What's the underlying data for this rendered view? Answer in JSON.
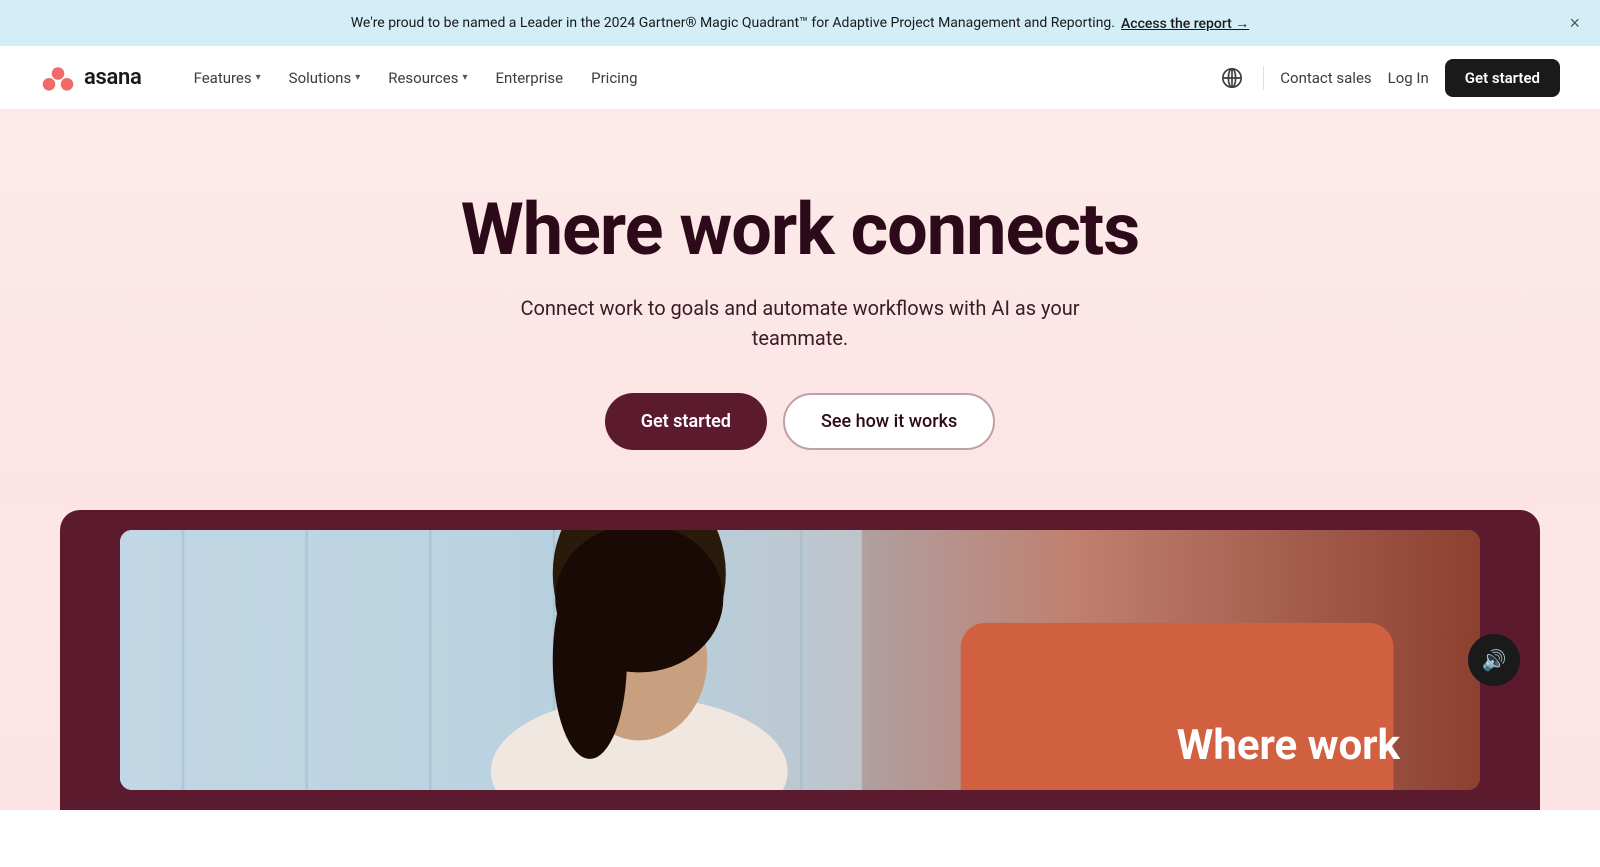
{
  "banner": {
    "text": "We're proud to be named a Leader in the 2024 Gartner® Magic Quadrant™ for Adaptive Project Management and Reporting.",
    "link_text": "Access the report →",
    "close_label": "×"
  },
  "nav": {
    "logo_name": "asana",
    "features_label": "Features",
    "solutions_label": "Solutions",
    "resources_label": "Resources",
    "enterprise_label": "Enterprise",
    "pricing_label": "Pricing",
    "contact_sales_label": "Contact sales",
    "login_label": "Log In",
    "get_started_label": "Get started"
  },
  "hero": {
    "title": "Where work connects",
    "subtitle": "Connect work to goals and automate workflows with AI as your teammate.",
    "cta_primary": "Get started",
    "cta_secondary": "See how it works"
  },
  "video": {
    "overlay_text": "Where  work",
    "mute_icon": "🔊"
  }
}
